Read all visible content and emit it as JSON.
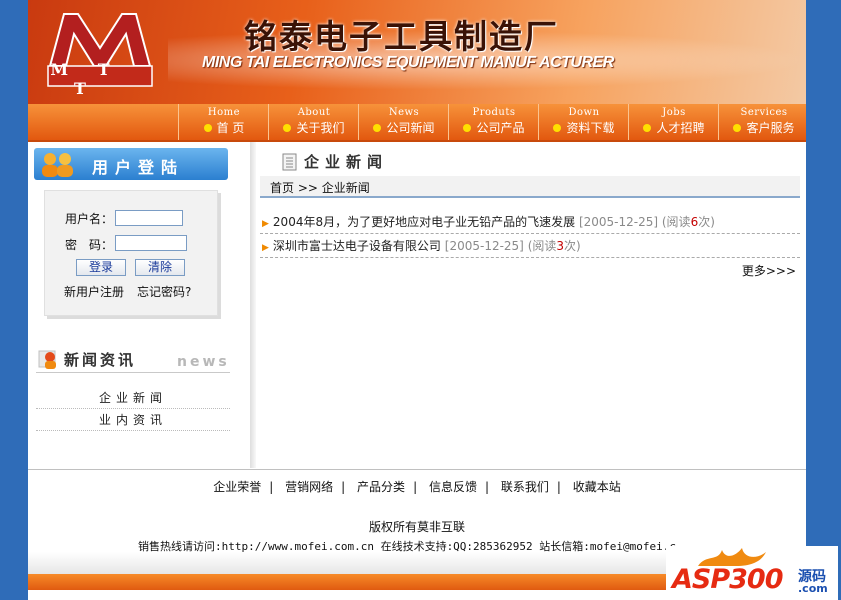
{
  "header": {
    "logo_text": "M T T",
    "title_cn": "铭泰电子工具制造厂",
    "title_en": "MING TAI ELECTRONICS EQUIPMENT MANUF ACTURER"
  },
  "nav": [
    {
      "en": "Home",
      "cn": "首 页"
    },
    {
      "en": "About",
      "cn": "关于我们"
    },
    {
      "en": "News",
      "cn": "公司新闻"
    },
    {
      "en": "Produts",
      "cn": "公司产品"
    },
    {
      "en": "Down",
      "cn": "资料下载"
    },
    {
      "en": "Jobs",
      "cn": "人才招聘"
    },
    {
      "en": "Services",
      "cn": "客户服务"
    }
  ],
  "login": {
    "title": "用户登陆",
    "username_label": "用户名：",
    "password_label": "密　码：",
    "login_button": "登录",
    "clear_button": "清除",
    "register_link": "新用户注册",
    "forgot_link": "忘记密码?"
  },
  "side_news": {
    "title": "新闻资讯",
    "title_en": "news",
    "links": [
      "企业新闻",
      "业内资讯"
    ]
  },
  "main": {
    "title": "企业新闻",
    "breadcrumb": "首页 >> 企业新闻",
    "news": [
      {
        "title": "2004年8月，为了更好地应对电子业无铅产品的飞速发展",
        "date": "[2005-12-25]",
        "reads_prefix": "(阅读",
        "reads": "6",
        "reads_suffix": "次)"
      },
      {
        "title": "深圳市富士达电子设备有限公司",
        "date": "[2005-12-25]",
        "reads_prefix": "(阅读",
        "reads": "3",
        "reads_suffix": "次)"
      }
    ],
    "more": "更多>>>"
  },
  "footer": {
    "links": [
      "企业荣誉",
      "营销网络",
      "产品分类",
      "信息反馈",
      "联系我们",
      "收藏本站"
    ],
    "copyright": "版权所有莫非互联",
    "contact": "销售热线请访问:http://www.mofei.com.cn 在线技术支持:QQ:285362952 站长信箱:mofei@mofei.c"
  },
  "watermark": {
    "text": "ASP300",
    "small1": "源码",
    "small2": ".com"
  },
  "colors": {
    "orange": "#e8601a",
    "blue_side": "#2f6cb8",
    "login_blue": "#2b7fd0",
    "read_count": "#c40000"
  }
}
